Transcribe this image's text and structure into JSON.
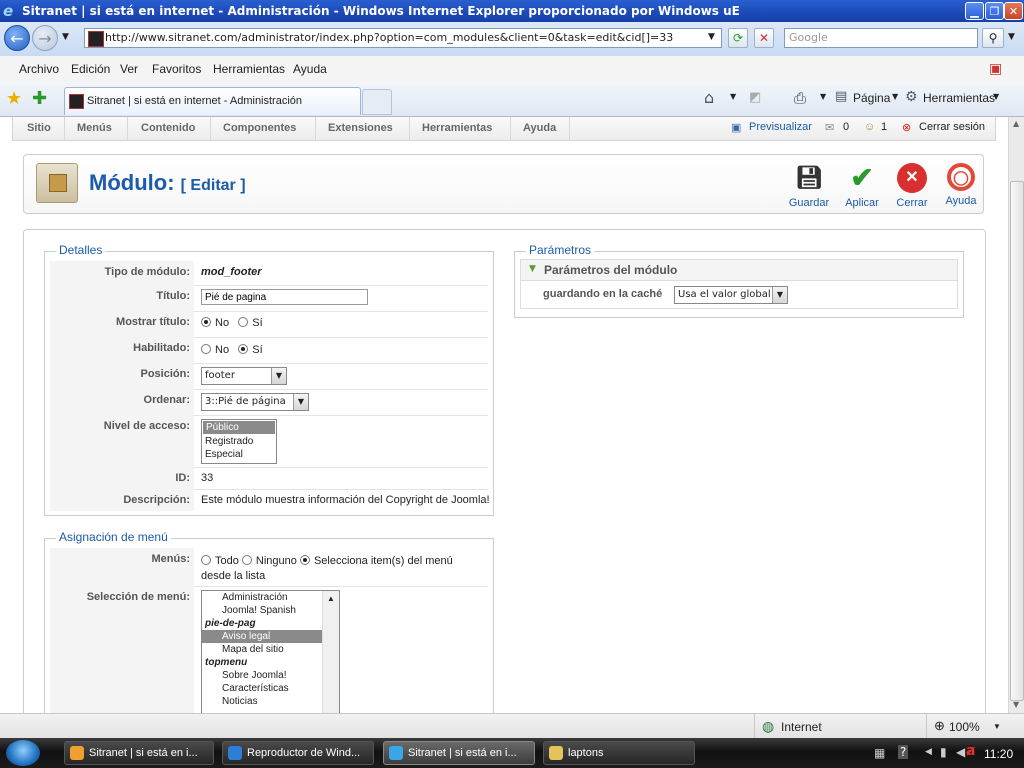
{
  "window": {
    "title": "Sitranet | si está en internet - Administración - Windows Internet Explorer proporcionado por Windows uE"
  },
  "address": {
    "url": "http://www.sitranet.com/administrator/index.php?option=com_modules&client=0&task=edit&cid[]=33",
    "search_placeholder": "Google"
  },
  "menubar": [
    "Archivo",
    "Edición",
    "Ver",
    "Favoritos",
    "Herramientas",
    "Ayuda"
  ],
  "tabs": {
    "active_tab": "Sitranet | si está en internet - Administración"
  },
  "commandbar": {
    "page": "Página",
    "tools": "Herramientas"
  },
  "joomla_menu": {
    "items": [
      "Sitio",
      "Menús",
      "Contenido",
      "Componentes",
      "Extensiones",
      "Herramientas",
      "Ayuda"
    ],
    "preview": "Previsualizar",
    "messages_count": "0",
    "users_count": "1",
    "logout": "Cerrar sesión"
  },
  "toolbar": {
    "title": "Módulo:",
    "subtitle": "[ Editar ]",
    "save": "Guardar",
    "apply": "Aplicar",
    "close": "Cerrar",
    "help": "Ayuda"
  },
  "details": {
    "legend": "Detalles",
    "type_label": "Tipo de módulo:",
    "type_value": "mod_footer",
    "title_label": "Título:",
    "title_value": "Pié de pagina",
    "show_title_label": "Mostrar título:",
    "enabled_label": "Habilitado:",
    "no": "No",
    "yes": "Sí",
    "show_title_selected": "No",
    "enabled_selected": "Sí",
    "position_label": "Posición:",
    "position_value": "footer",
    "order_label": "Ordenar:",
    "order_value": "3::Pié de página",
    "access_label": "Nivel de acceso:",
    "access_options": [
      "Público",
      "Registrado",
      "Especial"
    ],
    "access_selected": "Público",
    "id_label": "ID:",
    "id_value": "33",
    "desc_label": "Descripción:",
    "desc_value": "Este módulo muestra información del Copyright de Joomla!"
  },
  "menu_assignment": {
    "legend": "Asignación de menú",
    "menus_label": "Menús:",
    "all": "Todo",
    "none": "Ninguno",
    "select": "Selecciona item(s) del menú",
    "select_cont": "desde la lista",
    "selected_option": "Selecciona item(s) del menú",
    "selection_label": "Selección de menú:",
    "list": [
      {
        "text": "Administración",
        "kind": "opt"
      },
      {
        "text": "Joomla! Spanish",
        "kind": "opt"
      },
      {
        "text": "pie-de-pag",
        "kind": "grp"
      },
      {
        "text": "Aviso legal",
        "kind": "opt",
        "selected": true
      },
      {
        "text": "Mapa del sitio",
        "kind": "opt"
      },
      {
        "text": "topmenu",
        "kind": "grp"
      },
      {
        "text": "Sobre Joomla!",
        "kind": "opt"
      },
      {
        "text": "Características",
        "kind": "opt"
      },
      {
        "text": "Noticias",
        "kind": "opt"
      }
    ]
  },
  "parameters": {
    "legend": "Parámetros",
    "section": "Parámetros del módulo",
    "cache_label": "guardando en la caché",
    "cache_value": "Usa el valor global"
  },
  "statusbar": {
    "zone": "Internet",
    "zoom": "100%"
  },
  "taskbar": {
    "items": [
      "Sitranet | si está en i...",
      "Reproductor de Wind...",
      "Sitranet | si está en i...",
      "laptons"
    ],
    "clock": "11:20"
  }
}
